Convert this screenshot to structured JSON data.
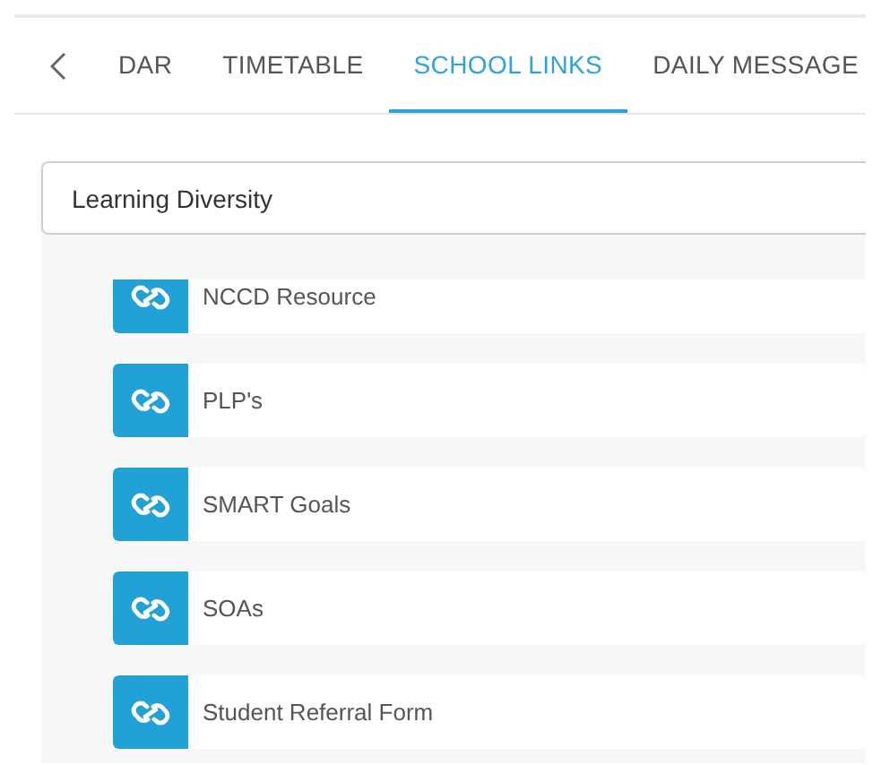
{
  "tabs": [
    {
      "label": "DAR",
      "selected": false
    },
    {
      "label": "TIMETABLE",
      "selected": false
    },
    {
      "label": "SCHOOL LINKS",
      "selected": true
    },
    {
      "label": "DAILY MESSAGE",
      "selected": false
    }
  ],
  "category_select": {
    "value": "Learning Diversity"
  },
  "links": [
    {
      "label": "NCCD Resource"
    },
    {
      "label": "PLP's"
    },
    {
      "label": "SMART Goals"
    },
    {
      "label": "SOAs"
    },
    {
      "label": "Student Referral Form"
    }
  ]
}
